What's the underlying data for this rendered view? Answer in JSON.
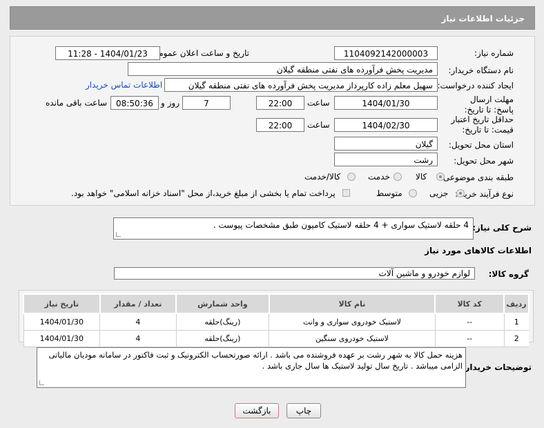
{
  "title": "جزئیات اطلاعات نیاز",
  "form": {
    "need_number_label": "شماره نیاز:",
    "need_number": "1104092142000003",
    "announce_label": "تاریخ و ساعت اعلان عمومی:",
    "announce_value": "1404/01/23 - 11:28",
    "buyer_label": "نام دستگاه خریدار:",
    "buyer_value": "مدیریت پخش فرآورده های نفتی منطقه گیلان",
    "requester_label": "ایجاد کننده درخواست:",
    "requester_value": "سهیل معلم زاده کارپرداز مدیریت پخش فرآورده های نفتی منطقه گیلان",
    "contact_link": "اطلاعات تماس خریدار",
    "deadline_label": "مهلت ارسال پاسخ: تا تاریخ:",
    "deadline_date": "1404/01/30",
    "time_label": "ساعت",
    "deadline_time": "22:00",
    "days_value": "7",
    "days_label": "روز و",
    "remaining_time": "08:50:36",
    "remaining_label": "ساعت باقی مانده",
    "validity_label": "حداقل تاریخ اعتبار قیمت: تا تاریخ:",
    "validity_date": "1404/02/30",
    "validity_time": "22:00",
    "province_label": "استان محل تحویل:",
    "province_value": "گیلان",
    "city_label": "شهر محل تحویل:",
    "city_value": "رشت",
    "category_label": "طبقه بندی موضوعی:",
    "category_options": [
      "کالا",
      "خدمت",
      "کالا/خدمت"
    ],
    "process_label": "نوع فرآیند خرید :",
    "process_options": [
      "جزیی",
      "متوسط"
    ],
    "payment_note": "پرداخت تمام یا بخشی از مبلغ خرید،از محل \"اسناد خزانه اسلامی\" خواهد بود."
  },
  "description": {
    "label": "شرح کلی نیاز:",
    "value": "4 حلقه لاستیک سواری + 4 حلقه لاستیک کامیون طبق مشخصات پیوست ."
  },
  "goods": {
    "section_title": "اطلاعات کالاهای مورد نیاز",
    "group_label": "گروه کالا:",
    "group_value": "لوازم خودرو و ماشین آلات",
    "columns": [
      "ردیف",
      "کد کالا",
      "نام کالا",
      "واحد شمارش",
      "تعداد / مقدار",
      "تاریخ نیاز"
    ],
    "rows": [
      [
        "1",
        "--",
        "لاستیک خودروی سواری و وانت",
        "(رینگ)حلقه",
        "4",
        "1404/01/30"
      ],
      [
        "2",
        "--",
        "لاستیک خودروی سنگین",
        "(رینگ)حلقه",
        "4",
        "1404/01/30"
      ]
    ]
  },
  "buyer_notes": {
    "label": "توضیحات خریدار:",
    "value": "هزینه حمل کالا به شهر رشت بر عهده فروشنده می باشد . ارائه صورتحساب الکترونیک و ثبت فاکتور در سامانه مودیان مالیاتی الزامی میباشد . تاریخ سال تولید لاستیک ها سال جاری باشد ."
  },
  "buttons": {
    "print": "چاپ",
    "back": "بازگشت"
  },
  "colors": {
    "header": "#9a9a9a",
    "link": "#1a4fb5",
    "back_border": "#c97a7a"
  }
}
